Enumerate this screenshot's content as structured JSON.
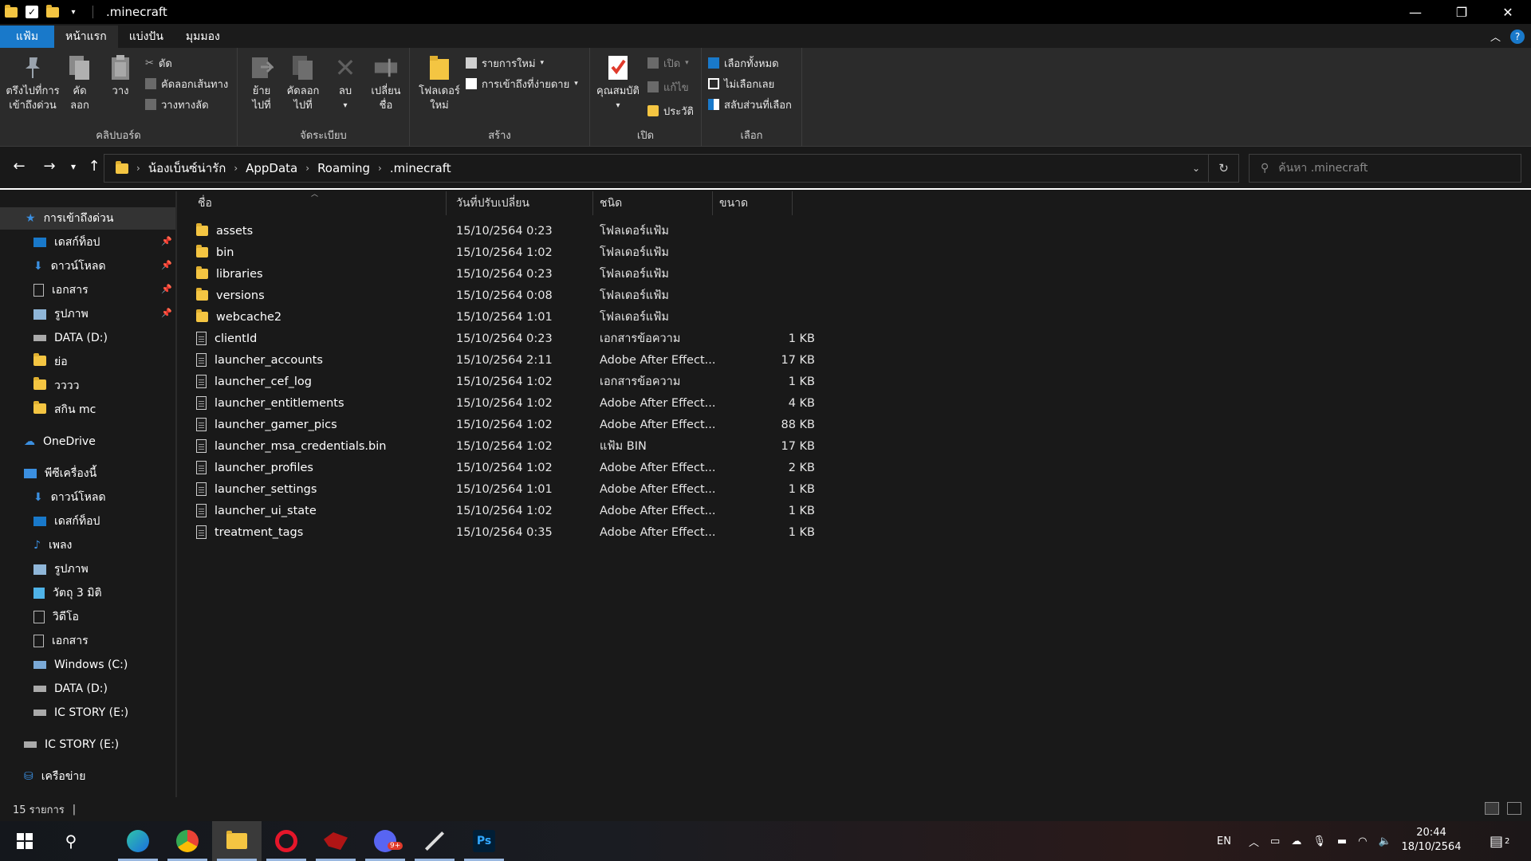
{
  "window": {
    "title": ".minecraft",
    "controls": [
      "—",
      "❐",
      "✕"
    ]
  },
  "ribbon_tabs": [
    {
      "label": "แฟ้ม"
    },
    {
      "label": "หน้าแรก"
    },
    {
      "label": "แบ่งปัน"
    },
    {
      "label": "มุมมอง"
    }
  ],
  "ribbon": {
    "clipboard": {
      "pin_label_1": "ตรึงไปที่การ",
      "pin_label_2": "เข้าถึงด่วน",
      "copy_label_1": "คัด",
      "copy_label_2": "ลอก",
      "paste_label": "วาง",
      "cut": "ตัด",
      "copy_path": "คัดลอกเส้นทาง",
      "paste_shortcut": "วางทางลัด",
      "group_label": "คลิปบอร์ด"
    },
    "organize": {
      "move_1": "ย้าย",
      "move_2": "ไปที่",
      "copyto_1": "คัดลอก",
      "copyto_2": "ไปที่",
      "delete": "ลบ",
      "rename_1": "เปลี่ยน",
      "rename_2": "ชื่อ",
      "group_label": "จัดระเบียบ"
    },
    "new": {
      "newfolder_1": "โฟลเดอร์",
      "newfolder_2": "ใหม่",
      "new_item": "รายการใหม่",
      "easy_access": "การเข้าถึงที่ง่ายดาย",
      "group_label": "สร้าง"
    },
    "open": {
      "properties": "คุณสมบัติ",
      "open": "เปิด",
      "edit": "แก้ไข",
      "history": "ประวัติ",
      "group_label": "เปิด"
    },
    "select": {
      "select_all": "เลือกทั้งหมด",
      "select_none": "ไม่เลือกเลย",
      "invert": "สลับส่วนที่เลือก",
      "group_label": "เลือก"
    }
  },
  "address": {
    "crumbs": [
      "น้องเบ็นซ์น่ารัก",
      "AppData",
      "Roaming",
      ".minecraft"
    ],
    "search_placeholder": "ค้นหา .minecraft"
  },
  "sidebar": {
    "items": [
      {
        "label": "การเข้าถึงด่วน"
      },
      {
        "label": "เดสก์ท็อป"
      },
      {
        "label": "ดาวน์โหลด"
      },
      {
        "label": "เอกสาร"
      },
      {
        "label": "รูปภาพ"
      },
      {
        "label": "DATA (D:)"
      },
      {
        "label": "ย่อ"
      },
      {
        "label": "วววว"
      },
      {
        "label": "สกิน mc"
      },
      {
        "label": "OneDrive"
      },
      {
        "label": "พีซีเครื่องนี้"
      },
      {
        "label": "ดาวน์โหลด"
      },
      {
        "label": "เดสก์ท็อป"
      },
      {
        "label": "เพลง"
      },
      {
        "label": "รูปภาพ"
      },
      {
        "label": "วัตถุ 3 มิติ"
      },
      {
        "label": "วิดีโอ"
      },
      {
        "label": "เอกสาร"
      },
      {
        "label": "Windows (C:)"
      },
      {
        "label": "DATA (D:)"
      },
      {
        "label": "IC STORY (E:)"
      },
      {
        "label": "IC STORY (E:)"
      },
      {
        "label": "เครือข่าย"
      }
    ]
  },
  "columns": {
    "name": "ชื่อ",
    "date": "วันที่ปรับเปลี่ยน",
    "type": "ชนิด",
    "size": "ขนาด"
  },
  "files": [
    {
      "name": "assets",
      "date": "15/10/2564 0:23",
      "type": "โฟลเดอร์แฟ้ม",
      "size": "",
      "kind": "folder"
    },
    {
      "name": "bin",
      "date": "15/10/2564 1:02",
      "type": "โฟลเดอร์แฟ้ม",
      "size": "",
      "kind": "folder"
    },
    {
      "name": "libraries",
      "date": "15/10/2564 0:23",
      "type": "โฟลเดอร์แฟ้ม",
      "size": "",
      "kind": "folder"
    },
    {
      "name": "versions",
      "date": "15/10/2564 0:08",
      "type": "โฟลเดอร์แฟ้ม",
      "size": "",
      "kind": "folder"
    },
    {
      "name": "webcache2",
      "date": "15/10/2564 1:01",
      "type": "โฟลเดอร์แฟ้ม",
      "size": "",
      "kind": "folder"
    },
    {
      "name": "clientId",
      "date": "15/10/2564 0:23",
      "type": "เอกสารข้อความ",
      "size": "1 KB",
      "kind": "file"
    },
    {
      "name": "launcher_accounts",
      "date": "15/10/2564 2:11",
      "type": "Adobe After Effect...",
      "size": "17 KB",
      "kind": "file"
    },
    {
      "name": "launcher_cef_log",
      "date": "15/10/2564 1:02",
      "type": "เอกสารข้อความ",
      "size": "1 KB",
      "kind": "file"
    },
    {
      "name": "launcher_entitlements",
      "date": "15/10/2564 1:02",
      "type": "Adobe After Effect...",
      "size": "4 KB",
      "kind": "file"
    },
    {
      "name": "launcher_gamer_pics",
      "date": "15/10/2564 1:02",
      "type": "Adobe After Effect...",
      "size": "88 KB",
      "kind": "file"
    },
    {
      "name": "launcher_msa_credentials.bin",
      "date": "15/10/2564 1:02",
      "type": "แฟ้ม BIN",
      "size": "17 KB",
      "kind": "file"
    },
    {
      "name": "launcher_profiles",
      "date": "15/10/2564 1:02",
      "type": "Adobe After Effect...",
      "size": "2 KB",
      "kind": "file"
    },
    {
      "name": "launcher_settings",
      "date": "15/10/2564 1:01",
      "type": "Adobe After Effect...",
      "size": "1 KB",
      "kind": "file"
    },
    {
      "name": "launcher_ui_state",
      "date": "15/10/2564 1:02",
      "type": "Adobe After Effect...",
      "size": "1 KB",
      "kind": "file"
    },
    {
      "name": "treatment_tags",
      "date": "15/10/2564 0:35",
      "type": "Adobe After Effect...",
      "size": "1 KB",
      "kind": "file"
    }
  ],
  "status": {
    "count": "15 รายการ"
  },
  "taskbar": {
    "apps": [
      "start-icon",
      "search-icon",
      "edge-icon",
      "chrome-icon",
      "file-explorer-icon",
      "opera-icon",
      "game-icon",
      "discord-icon",
      "pen-icon",
      "photoshop-icon"
    ],
    "discord_badge": "9+",
    "ps_label": "Ps",
    "language": "EN",
    "time": "20:44",
    "date": "18/10/2564",
    "notif_count": "2"
  },
  "colors": {
    "accent": "#1979ca",
    "folder": "#f4c542",
    "background": "#191919",
    "ribbon": "#2b2b2b"
  }
}
